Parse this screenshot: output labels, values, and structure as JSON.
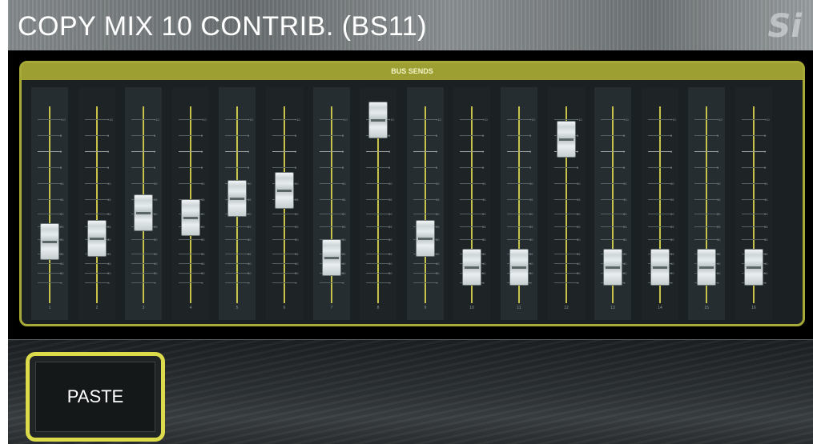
{
  "window": {
    "title": "COPY MIX 10 CONTRIB. (BS11)",
    "logo": "Si"
  },
  "panel": {
    "header": "BUS SENDS",
    "scale_labels": [
      "+10",
      "5",
      "0",
      "5",
      "10",
      "15",
      "20",
      "25",
      "30",
      "35",
      "40",
      "50",
      "∞"
    ]
  },
  "channels": [
    {
      "label": "1",
      "level": 0.22
    },
    {
      "label": "2",
      "level": 0.24
    },
    {
      "label": "3",
      "level": 0.4
    },
    {
      "label": "4",
      "level": 0.37
    },
    {
      "label": "5",
      "level": 0.49
    },
    {
      "label": "6",
      "level": 0.54
    },
    {
      "label": "7",
      "level": 0.12
    },
    {
      "label": "8",
      "level": 0.98
    },
    {
      "label": "9",
      "level": 0.24
    },
    {
      "label": "10",
      "level": 0.06
    },
    {
      "label": "11",
      "level": 0.06
    },
    {
      "label": "12",
      "level": 0.86
    },
    {
      "label": "13",
      "level": 0.06
    },
    {
      "label": "14",
      "level": 0.06
    },
    {
      "label": "15",
      "level": 0.06
    },
    {
      "label": "16",
      "level": 0.06
    }
  ],
  "actions": {
    "paste_label": "PASTE"
  },
  "colors": {
    "accent": "#a8aa37",
    "track": "#c7c24a"
  }
}
